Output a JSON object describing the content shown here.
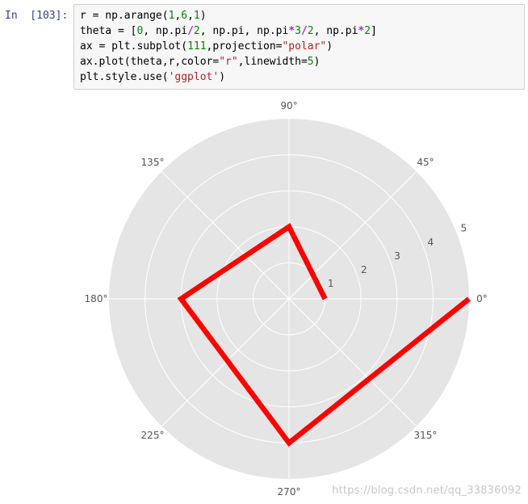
{
  "cell": {
    "prompt": "In  [103]:",
    "code_lines": [
      [
        {
          "t": "r = np.arange(",
          "c": "plain"
        },
        {
          "t": "1",
          "c": "num"
        },
        {
          "t": ",",
          "c": "plain"
        },
        {
          "t": "6",
          "c": "num"
        },
        {
          "t": ",",
          "c": "plain"
        },
        {
          "t": "1",
          "c": "num"
        },
        {
          "t": ")",
          "c": "plain"
        }
      ],
      [
        {
          "t": "theta = [",
          "c": "plain"
        },
        {
          "t": "0",
          "c": "num"
        },
        {
          "t": ", np.pi",
          "c": "plain"
        },
        {
          "t": "/",
          "c": "op"
        },
        {
          "t": "2",
          "c": "num"
        },
        {
          "t": ", np.pi, np.pi",
          "c": "plain"
        },
        {
          "t": "*",
          "c": "op"
        },
        {
          "t": "3",
          "c": "num"
        },
        {
          "t": "/",
          "c": "op"
        },
        {
          "t": "2",
          "c": "num"
        },
        {
          "t": ", np.pi",
          "c": "plain"
        },
        {
          "t": "*",
          "c": "op"
        },
        {
          "t": "2",
          "c": "num"
        },
        {
          "t": "]",
          "c": "plain"
        }
      ],
      [
        {
          "t": "ax = plt.subplot(",
          "c": "plain"
        },
        {
          "t": "111",
          "c": "num"
        },
        {
          "t": ",projection=",
          "c": "plain"
        },
        {
          "t": "\"polar\"",
          "c": "str"
        },
        {
          "t": ")",
          "c": "plain"
        }
      ],
      [
        {
          "t": "ax.plot(theta,r,color=",
          "c": "plain"
        },
        {
          "t": "\"r\"",
          "c": "str"
        },
        {
          "t": ",linewidth=",
          "c": "plain"
        },
        {
          "t": "5",
          "c": "num"
        },
        {
          "t": ")",
          "c": "plain"
        }
      ],
      [
        {
          "t": "plt.style.use(",
          "c": "plain"
        },
        {
          "t": "'ggplot'",
          "c": "str"
        },
        {
          "t": ")",
          "c": "plain"
        }
      ]
    ]
  },
  "watermark": "https://blog.csdn.net/qq_33836092",
  "colors": {
    "axes_bg": "#e5e5e5",
    "grid": "#ffffff",
    "line": "#ff0000",
    "tick_text": "#555555"
  },
  "chart_data": {
    "type": "line",
    "projection": "polar",
    "theta_deg": [
      0,
      90,
      180,
      270,
      360
    ],
    "r": [
      1,
      2,
      3,
      4,
      5
    ],
    "rlim": [
      0,
      5
    ],
    "r_ticks": [
      "1",
      "2",
      "3",
      "4",
      "5"
    ],
    "theta_ticks": [
      "0°",
      "45°",
      "90°",
      "135°",
      "180°",
      "225°",
      "270°",
      "315°"
    ],
    "grid": true,
    "line_color": "#ff0000",
    "line_width": 5
  }
}
